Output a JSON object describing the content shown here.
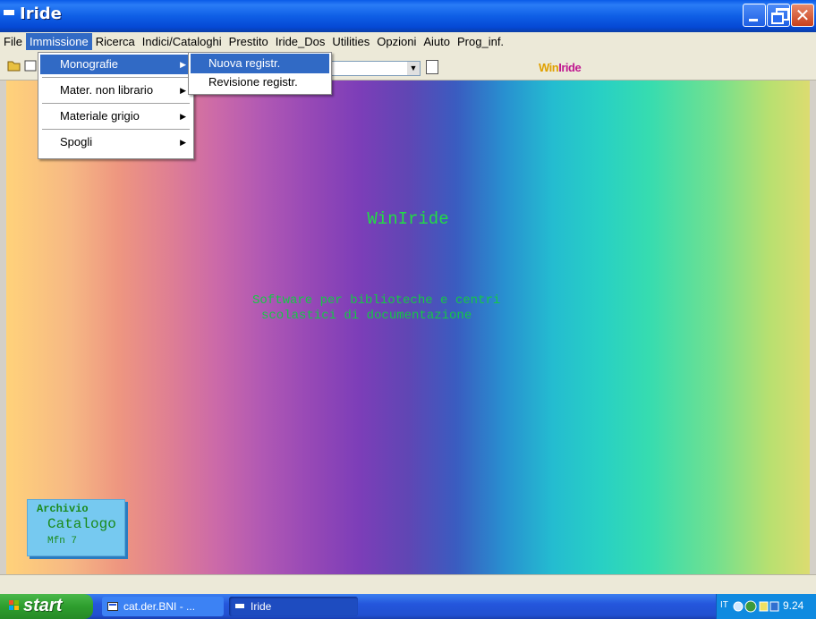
{
  "window": {
    "title": "Iride"
  },
  "menubar": [
    {
      "label": "File"
    },
    {
      "label": "Immissione",
      "active": true
    },
    {
      "label": "Ricerca"
    },
    {
      "label": "Indici/Cataloghi"
    },
    {
      "label": "Prestito"
    },
    {
      "label": "Iride_Dos"
    },
    {
      "label": "Utilities"
    },
    {
      "label": "Opzioni"
    },
    {
      "label": "Aiuto"
    },
    {
      "label": "Prog_inf."
    }
  ],
  "toolbar": {
    "logo_main": "Win",
    "logo_accent": "Iride"
  },
  "menu_immissione": [
    {
      "label": "Monografie",
      "has_submenu": true,
      "highlighted": true
    },
    {
      "label": "Mater. non librario",
      "has_submenu": true
    },
    {
      "label": "Materiale grigio",
      "has_submenu": true
    },
    {
      "label": "Spogli",
      "has_submenu": true
    }
  ],
  "menu_monografie": [
    {
      "label": "Nuova registr.",
      "highlighted": true
    },
    {
      "label": "Revisione registr."
    }
  ],
  "main": {
    "app_title": "WinIride",
    "subtitle_line1": "Software per biblioteche e centri",
    "subtitle_line2": "scolastici di documentazione",
    "archive": {
      "label": "Archivio",
      "name": "Catalogo",
      "mfn": "Mfn 7"
    }
  },
  "taskbar": {
    "start_label": "start",
    "tasks": [
      {
        "label": "cat.der.BNI - ..."
      },
      {
        "label": "Iride",
        "active": true
      }
    ],
    "tray_lang": "IT",
    "clock": "9.24"
  },
  "colors": {
    "menu_highlight": "#316ac5",
    "titlebar_blue": "#0548d4",
    "app_text_green": "#22dd44"
  }
}
